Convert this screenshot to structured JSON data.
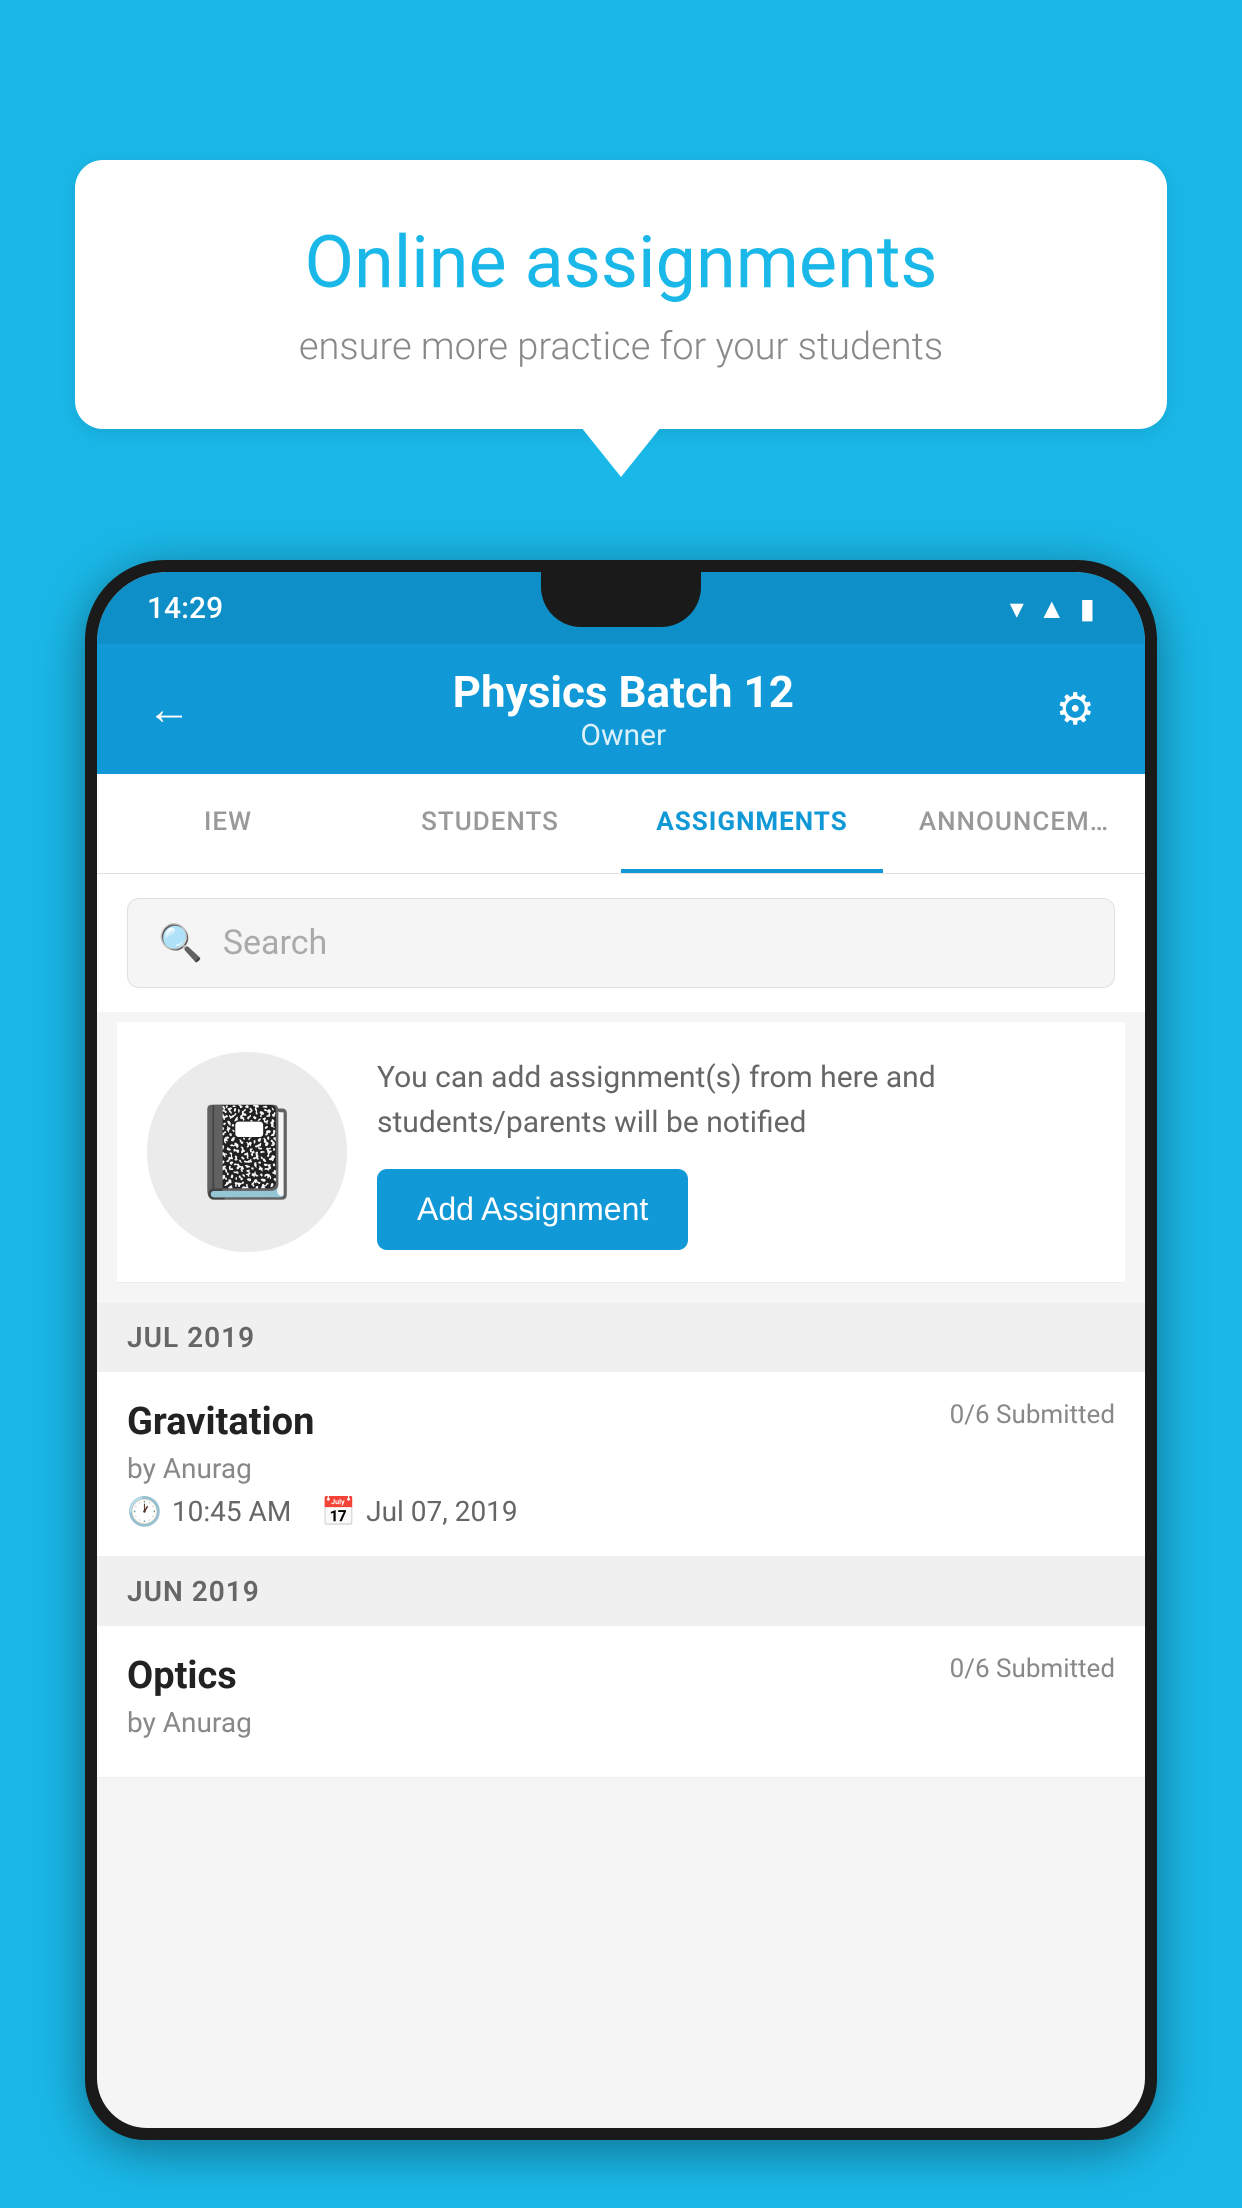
{
  "background_color": "#1ab8e8",
  "speech_bubble": {
    "title": "Online assignments",
    "subtitle": "ensure more practice for your students"
  },
  "status_bar": {
    "time": "14:29",
    "icons": [
      "wifi",
      "signal",
      "battery"
    ]
  },
  "app_header": {
    "title": "Physics Batch 12",
    "subtitle": "Owner",
    "back_label": "←",
    "settings_label": "⚙"
  },
  "tabs": [
    {
      "label": "IEW",
      "active": false
    },
    {
      "label": "STUDENTS",
      "active": false
    },
    {
      "label": "ASSIGNMENTS",
      "active": true
    },
    {
      "label": "ANNOUNCEM…",
      "active": false
    }
  ],
  "search": {
    "placeholder": "Search"
  },
  "promo": {
    "description": "You can add assignment(s) from here and students/parents will be notified",
    "button_label": "Add Assignment"
  },
  "sections": [
    {
      "header": "JUL 2019",
      "assignments": [
        {
          "name": "Gravitation",
          "submitted": "0/6 Submitted",
          "by": "by Anurag",
          "time": "10:45 AM",
          "date": "Jul 07, 2019"
        }
      ]
    },
    {
      "header": "JUN 2019",
      "assignments": [
        {
          "name": "Optics",
          "submitted": "0/6 Submitted",
          "by": "by Anurag",
          "time": "",
          "date": ""
        }
      ]
    }
  ]
}
